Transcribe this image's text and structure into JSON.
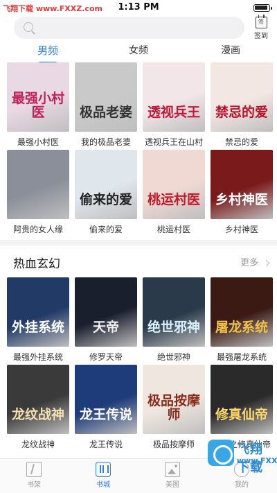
{
  "status_bar": {
    "left_text": "飞翔下载 www.FXXZ.com",
    "time": "1:13 PM"
  },
  "search": {
    "placeholder": ""
  },
  "signin": {
    "icon_text": "签",
    "label": "签到"
  },
  "tabs": [
    {
      "label": "男频",
      "active": true
    },
    {
      "label": "女频",
      "active": false
    },
    {
      "label": "漫画",
      "active": false
    }
  ],
  "top_books": [
    {
      "name": "最强小村医",
      "cover_text": "最强小村医",
      "bg": "#e9d9e4",
      "fg": "#c2205a"
    },
    {
      "name": "我的极品老婆",
      "cover_text": "极品老婆",
      "bg": "#c9c9c9",
      "fg": "#333333"
    },
    {
      "name": "透视兵王在山村",
      "cover_text": "透视兵王",
      "bg": "#f2e6e8",
      "fg": "#c2183a"
    },
    {
      "name": "禁忌的爱",
      "cover_text": "禁忌的爱",
      "bg": "#f3e7e3",
      "fg": "#b7122a"
    },
    {
      "name": "阿贵的女人缘",
      "cover_text": "",
      "bg": "#8a8f9a",
      "fg": "#ffffff"
    },
    {
      "name": "偷来的爱",
      "cover_text": "偷来的爱",
      "bg": "#dfe6ec",
      "fg": "#222222"
    },
    {
      "name": "桃运村医",
      "cover_text": "桃运村医",
      "bg": "#f1d9d3",
      "fg": "#c21a2a"
    },
    {
      "name": "乡村神医",
      "cover_text": "乡村神医",
      "bg": "#7a1a1a",
      "fg": "#ffffff"
    }
  ],
  "section": {
    "title": "热血玄幻",
    "more": "更多"
  },
  "section_books": [
    {
      "name": "最强外挂系统",
      "cover_text": "外挂系统",
      "bg": "#223a66",
      "fg": "#ffffff"
    },
    {
      "name": "修罗天帝",
      "cover_text": "天帝",
      "bg": "#1a1f2e",
      "fg": "#f0f0f0"
    },
    {
      "name": "绝世邪神",
      "cover_text": "绝世邪神",
      "bg": "#2a3a4a",
      "fg": "#d8f0ff"
    },
    {
      "name": "最强屠龙系统",
      "cover_text": "屠龙系统",
      "bg": "#3a1a12",
      "fg": "#f2c14a"
    },
    {
      "name": "龙纹战神",
      "cover_text": "龙纹战神",
      "bg": "#3a3a3a",
      "fg": "#f3e0b0"
    },
    {
      "name": "龙王传说",
      "cover_text": "龙王传说",
      "bg": "#1e3b7a",
      "fg": "#ffffff"
    },
    {
      "name": "极品按摩师",
      "cover_text": "极品按摩师",
      "bg": "#efe7df",
      "fg": "#8a2c1a"
    },
    {
      "name": "都市之修真仙帝",
      "cover_text": "修真仙帝",
      "bg": "#2a2a2a",
      "fg": "#ffd86a"
    }
  ],
  "bottom_nav": [
    {
      "label": "书架",
      "icon": "bookshelf-icon",
      "active": false
    },
    {
      "label": "书城",
      "icon": "bookstore-icon",
      "active": true
    },
    {
      "label": "美图",
      "icon": "picture-icon",
      "active": false
    },
    {
      "label": "我的",
      "icon": "profile-icon",
      "active": false
    }
  ],
  "watermark": {
    "title": "飞翔下载",
    "url": "www.FXXZ.com"
  },
  "colors": {
    "accent": "#2f7ff0"
  }
}
